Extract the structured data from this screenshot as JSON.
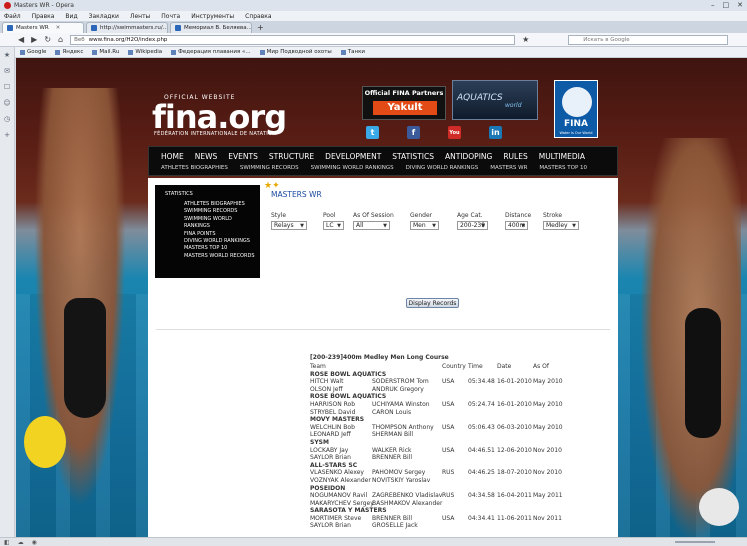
{
  "window": {
    "title": "Masters WR - Opera"
  },
  "menu": [
    "Файл",
    "Правка",
    "Вид",
    "Закладки",
    "Ленты",
    "Почта",
    "Инструменты",
    "Справка"
  ],
  "tabs": [
    {
      "label": "Masters WR",
      "active": true
    },
    {
      "label": "http://swimmasters.ru/...",
      "active": false
    },
    {
      "label": "Мемориал В. Беляева...",
      "active": false
    }
  ],
  "address": {
    "prefix": "Веб",
    "url": "www.fina.org/H2O/index.php",
    "search_placeholder": "Искать в Google"
  },
  "bookmarks": [
    "Google",
    "Яндекс",
    "Mail.Ru",
    "Wikipedia",
    "Федерация плавания «...",
    "Мир Подводной охоты",
    "Танки"
  ],
  "header": {
    "tagline": "OFFICIAL WEBSITE",
    "logo": "fina.org",
    "logo_sub": "FÉDÉRATION INTERNATIONALE DE NATATION",
    "partners_label": "Official FINA Partners",
    "partner_name": "Yakult",
    "aquatics_label": "AQUATICS",
    "aquatics_world": "world",
    "fina_label": "FINA",
    "fina_slogan": "Water is Our World"
  },
  "social": [
    {
      "icon": "twitter-icon",
      "glyph": "t",
      "color": "#3aa9e8"
    },
    {
      "icon": "facebook-icon",
      "glyph": "f",
      "color": "#3b5a9a"
    },
    {
      "icon": "youtube-icon",
      "glyph": "You",
      "color": "#d12b27"
    },
    {
      "icon": "linkedin-icon",
      "glyph": "in",
      "color": "#1b77b5"
    }
  ],
  "nav": {
    "main": [
      "HOME",
      "NEWS",
      "EVENTS",
      "STRUCTURE",
      "DEVELOPMENT",
      "STATISTICS",
      "ANTIDOPING",
      "RULES",
      "MULTIMEDIA"
    ],
    "sub": [
      "ATHLETES BIOGRAPHIES",
      "SWIMMING RECORDS",
      "SWIMMING WORLD RANKINGS",
      "DIVING WORLD RANKINGS",
      "MASTERS WR",
      "MASTERS TOP 10"
    ]
  },
  "sidebar": {
    "title": "STATISTICS",
    "items": [
      "ATHLETES BIOGRAPHIES",
      "SWIMMING RECORDS",
      "SWIMMING WORLD",
      "RANKINGS",
      "FINA POINTS",
      "DIVING WORLD RANKINGS",
      "MASTERS TOP 10",
      "MASTERS WORLD RECORDS"
    ]
  },
  "page_title": "MASTERS WR",
  "filters": {
    "style": {
      "label": "Style",
      "value": "Relays"
    },
    "pool": {
      "label": "Pool",
      "value": "LC"
    },
    "session": {
      "label": "As Of Session",
      "value": "All"
    },
    "gender": {
      "label": "Gender",
      "value": "Men"
    },
    "age": {
      "label": "Age Cat.",
      "value": "200-239"
    },
    "distance": {
      "label": "Distance",
      "value": "400m"
    },
    "stroke": {
      "label": "Stroke",
      "value": "Medley"
    },
    "button": "Display Records"
  },
  "records": {
    "caption": "[200-239]400m Medley Men Long Course",
    "headers": {
      "team": "Team",
      "country": "Country",
      "time": "Time",
      "date": "Date",
      "asof": "As Of"
    },
    "rows": [
      {
        "team": "ROSE BOWL AQUATICS",
        "a1": "",
        "a2": "",
        "country": "",
        "time": "",
        "date": "",
        "asof": "",
        "grp": true
      },
      {
        "team": "",
        "a1": "HITCH Walt",
        "a2": "SODERSTROM Tom",
        "country": "USA",
        "time": "05:34.48",
        "date": "16-01-2010",
        "asof": "May 2010",
        "grp": false
      },
      {
        "team": "",
        "a1": "OLSON Jeff",
        "a2": "ANDRUK Gregory",
        "country": "",
        "time": "",
        "date": "",
        "asof": "",
        "grp": false
      },
      {
        "team": "ROSE BOWL AQUATICS",
        "a1": "",
        "a2": "",
        "country": "",
        "time": "",
        "date": "",
        "asof": "",
        "grp": true
      },
      {
        "team": "",
        "a1": "HARRISON Rob",
        "a2": "UCHIYAMA Winston",
        "country": "USA",
        "time": "05:24.74",
        "date": "16-01-2010",
        "asof": "May 2010",
        "grp": false
      },
      {
        "team": "",
        "a1": "STRYBEL David",
        "a2": "CARON Louis",
        "country": "",
        "time": "",
        "date": "",
        "asof": "",
        "grp": false
      },
      {
        "team": "MOVY MASTERS",
        "a1": "",
        "a2": "",
        "country": "",
        "time": "",
        "date": "",
        "asof": "",
        "grp": true
      },
      {
        "team": "",
        "a1": "WELCHLIN Bob",
        "a2": "THOMPSON Anthony",
        "country": "USA",
        "time": "05:06.43",
        "date": "06-03-2010",
        "asof": "May 2010",
        "grp": false
      },
      {
        "team": "",
        "a1": "LEONARD Jeff",
        "a2": "SHERMAN Bill",
        "country": "",
        "time": "",
        "date": "",
        "asof": "",
        "grp": false
      },
      {
        "team": "SYSM",
        "a1": "",
        "a2": "",
        "country": "",
        "time": "",
        "date": "",
        "asof": "",
        "grp": true
      },
      {
        "team": "",
        "a1": "LOCKABY Jay",
        "a2": "WALKER Rick",
        "country": "USA",
        "time": "04:46.51",
        "date": "12-06-2010",
        "asof": "Nov 2010",
        "grp": false
      },
      {
        "team": "",
        "a1": "SAYLOR Brian",
        "a2": "BRENNER Bill",
        "country": "",
        "time": "",
        "date": "",
        "asof": "",
        "grp": false
      },
      {
        "team": "ALL-STARS SC",
        "a1": "",
        "a2": "",
        "country": "",
        "time": "",
        "date": "",
        "asof": "",
        "grp": true
      },
      {
        "team": "",
        "a1": "VLASENKO Alexey",
        "a2": "PAHOMOV Sergey",
        "country": "RUS",
        "time": "04:46.25",
        "date": "18-07-2010",
        "asof": "Nov 2010",
        "grp": false
      },
      {
        "team": "",
        "a1": "VOZNYAK Alexander",
        "a2": "NOVITSKIY Yaroslav",
        "country": "",
        "time": "",
        "date": "",
        "asof": "",
        "grp": false
      },
      {
        "team": "POSEIDON",
        "a1": "",
        "a2": "",
        "country": "",
        "time": "",
        "date": "",
        "asof": "",
        "grp": true
      },
      {
        "team": "",
        "a1": "NOGUMANOV Ravil",
        "a2": "ZAGREBENKO Vladislav",
        "country": "RUS",
        "time": "04:34.58",
        "date": "16-04-2011",
        "asof": "May 2011",
        "grp": false
      },
      {
        "team": "",
        "a1": "MAKARYCHEV Sergey",
        "a2": "BASHMAKOV Alexander",
        "country": "",
        "time": "",
        "date": "",
        "asof": "",
        "grp": false
      },
      {
        "team": "SARASOTA Y MASTERS",
        "a1": "",
        "a2": "",
        "country": "",
        "time": "",
        "date": "",
        "asof": "",
        "grp": true
      },
      {
        "team": "",
        "a1": "MORTIMER Steve",
        "a2": "BRENNER Bill",
        "country": "USA",
        "time": "04:34.41",
        "date": "11-06-2011",
        "asof": "Nov 2011",
        "grp": false
      },
      {
        "team": "",
        "a1": "SAYLOR Brian",
        "a2": "GROSELLE Jack",
        "country": "",
        "time": "",
        "date": "",
        "asof": "",
        "grp": false
      }
    ]
  }
}
